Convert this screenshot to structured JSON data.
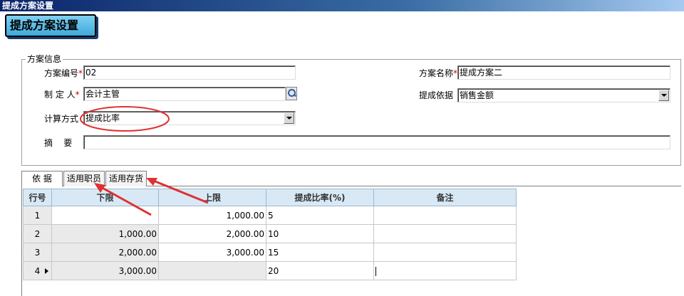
{
  "window": {
    "title": "提成方案设置"
  },
  "page": {
    "heading": "提成方案设置"
  },
  "scheme_info": {
    "legend": "方案信息",
    "code_label": "方案编号",
    "code_value": "02",
    "name_label": "方案名称",
    "name_value": "提成方案二",
    "creator_label": "制 定 人",
    "creator_value": "会计主管",
    "basis_label": "提成依据",
    "basis_value": "销售金额",
    "calc_label": "计算方式",
    "calc_value": "提成比率",
    "summary_label": "摘    要",
    "summary_value": "",
    "required_mark": "*"
  },
  "tabs": [
    {
      "label": "依  据"
    },
    {
      "label": "适用职员"
    },
    {
      "label": "适用存货"
    }
  ],
  "grid": {
    "headers": [
      "行号",
      "下限",
      "上限",
      "提成比率(%)",
      "备注"
    ],
    "rows": [
      {
        "no": "1",
        "lower": "",
        "upper": "1,000.00",
        "rate": "5",
        "note": ""
      },
      {
        "no": "2",
        "lower": "1,000.00",
        "upper": "2,000.00",
        "rate": "10",
        "note": ""
      },
      {
        "no": "3",
        "lower": "2,000.00",
        "upper": "3,000.00",
        "rate": "15",
        "note": ""
      },
      {
        "no": "4",
        "lower": "3,000.00",
        "upper": "",
        "rate": "20",
        "note": ""
      }
    ]
  },
  "colors": {
    "annotation": "#e03030",
    "header_bg": "#d8e9f5",
    "titlebar": "#0a246a"
  }
}
